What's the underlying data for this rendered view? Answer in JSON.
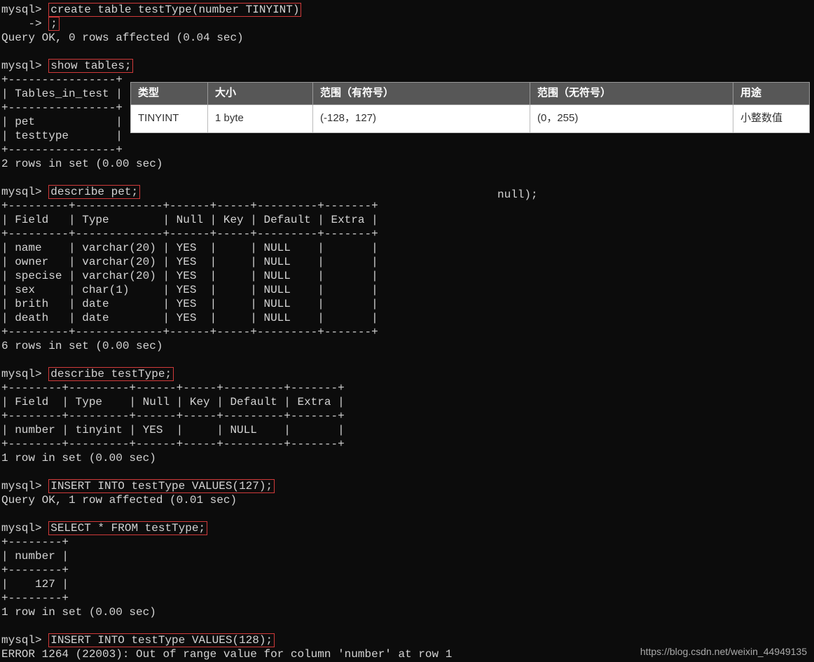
{
  "prompt": "mysql>",
  "cont_prompt": "    ->",
  "cmds": {
    "create_table": "create table testType(number TINYINT)",
    "create_table_cont": ";",
    "show_tables": "show tables;",
    "describe_pet": "describe pet;",
    "describe_testtype": "describe testType;",
    "insert_127": "INSERT INTO testType VALUES(127);",
    "select_all": "SELECT * FROM testType;",
    "insert_128": "INSERT INTO testType VALUES(128);"
  },
  "msgs": {
    "create_ok": "Query OK, 0 rows affected (0.04 sec)",
    "tables_divider": "+----------------+",
    "tables_header": "| Tables_in_test |",
    "tables_row1": "| pet            |",
    "tables_row2": "| testtype       |",
    "tables_footer": "2 rows in set (0.00 sec)",
    "pet_divider": "+---------+-------------+------+-----+---------+-------+",
    "pet_header": "| Field   | Type        | Null | Key | Default | Extra |",
    "pet_rows": [
      "| name    | varchar(20) | YES  |     | NULL    |       |",
      "| owner   | varchar(20) | YES  |     | NULL    |       |",
      "| specise | varchar(20) | YES  |     | NULL    |       |",
      "| sex     | char(1)     | YES  |     | NULL    |       |",
      "| brith   | date        | YES  |     | NULL    |       |",
      "| death   | date        | YES  |     | NULL    |       |"
    ],
    "pet_footer": "6 rows in set (0.00 sec)",
    "tt_divider": "+--------+---------+------+-----+---------+-------+",
    "tt_header": "| Field  | Type    | Null | Key | Default | Extra |",
    "tt_row": "| number | tinyint | YES  |     | NULL    |       |",
    "tt_footer": "1 row in set (0.00 sec)",
    "insert_ok": "Query OK, 1 row affected (0.01 sec)",
    "sel_divider": "+--------+",
    "sel_header": "| number |",
    "sel_row": "|    127 |",
    "sel_footer": "1 row in set (0.00 sec)",
    "error_128": "ERROR 1264 (22003): Out of range value for column 'number' at row 1",
    "stray_null": " null);"
  },
  "overlay": {
    "headers": [
      "类型",
      "大小",
      "范围（有符号）",
      "范围（无符号）",
      "用途"
    ],
    "row": [
      "TINYINT",
      "1 byte",
      "(-128，127)",
      "(0，255)",
      "小整数值"
    ]
  },
  "watermark": "https://blog.csdn.net/weixin_44949135"
}
